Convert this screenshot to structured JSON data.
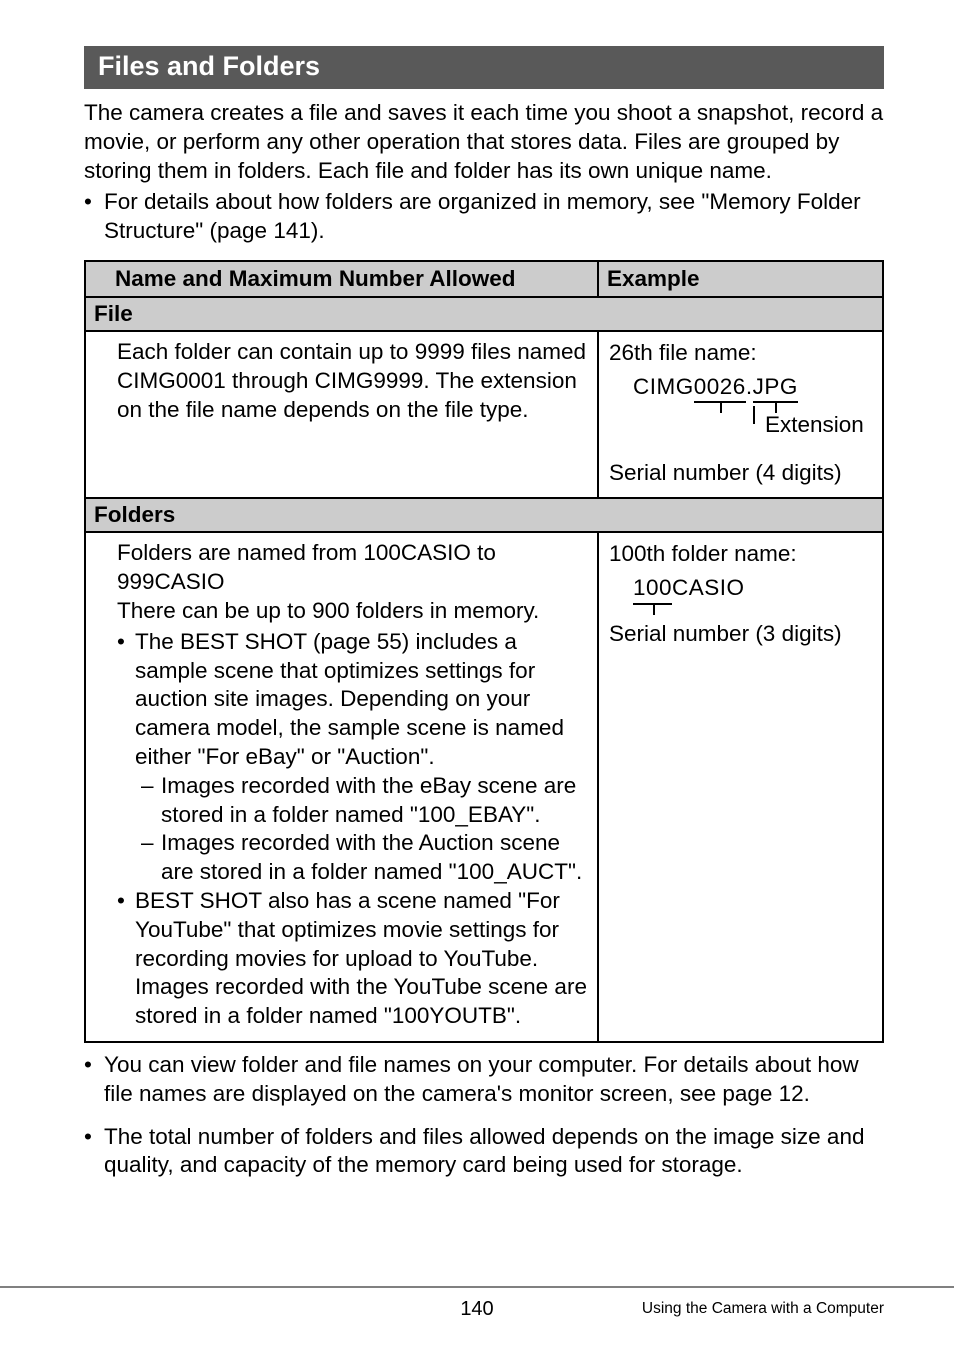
{
  "section_title": "Files and Folders",
  "intro": "The camera creates a file and saves it each time you shoot a snapshot, record a movie, or perform any other operation that stores data. Files are grouped by storing them in folders. Each file and folder has its own unique name.",
  "intro_bullet": "For details about how folders are organized in memory, see \"Memory Folder Structure\" (page 141).",
  "table": {
    "headers": {
      "name": "Name and Maximum Number Allowed",
      "example": "Example"
    },
    "file_header": "File",
    "file_desc": "Each folder can contain up to 9999 files named CIMG0001 through CIMG9999. The extension on the file name depends on the file type.",
    "file_example": {
      "title": "26th file name:",
      "prefix": "CIMG",
      "serial": "0026",
      "dot": ".",
      "ext": "JPG",
      "ext_label": "Extension",
      "serial_label": "Serial number (4 digits)"
    },
    "folders_header": "Folders",
    "folders_desc_lines": [
      "Folders are named from 100CASIO to 999CASIO",
      "There can be up to 900 folders in memory."
    ],
    "folders_bullets": [
      {
        "text": "The BEST SHOT (page 55) includes a sample scene that optimizes settings for auction site images. Depending on your camera model, the sample scene is named either \"For eBay\" or \"Auction\".",
        "subs": [
          "Images recorded with the eBay scene are stored in a folder named \"100_EBAY\".",
          "Images recorded with the Auction scene are stored in a folder named \"100_AUCT\"."
        ]
      },
      {
        "text": "BEST SHOT also has a scene named \"For YouTube\" that optimizes movie settings for recording movies for upload to YouTube. Images recorded with the YouTube scene are stored in a folder named \"100YOUTB\"."
      }
    ],
    "folders_example": {
      "title": "100th folder name:",
      "serial": "100",
      "suffix": "CASIO",
      "serial_label": "Serial number (3 digits)"
    }
  },
  "after_bullets": [
    "You can view folder and file names on your computer. For details about how file names are displayed on the camera's monitor screen, see page 12.",
    "The total number of folders and files allowed depends on the image size and quality, and capacity of the memory card being used for storage."
  ],
  "footer": {
    "page": "140",
    "right": "Using the Camera with a Computer"
  }
}
